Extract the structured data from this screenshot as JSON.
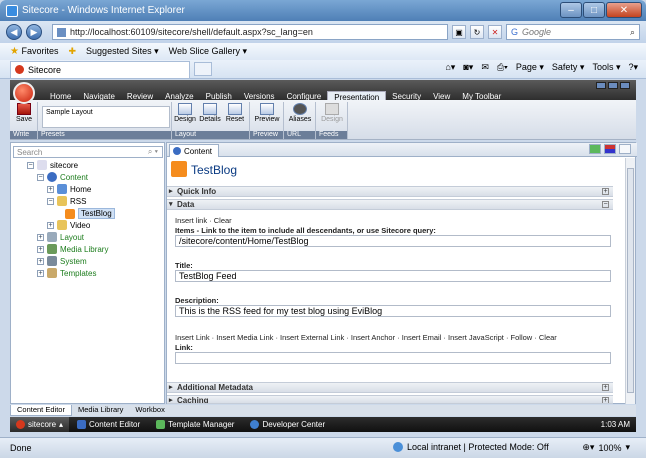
{
  "browser": {
    "title": "Sitecore - Windows Internet Explorer",
    "url": "http://localhost:60109/sitecore/shell/default.aspx?sc_lang=en",
    "search_placeholder": "Google",
    "favorites_label": "Favorites",
    "suggested_sites": "Suggested Sites ▾",
    "web_slice": "Web Slice Gallery ▾",
    "tab_label": "Sitecore",
    "cmd_page": "Page ▾",
    "cmd_safety": "Safety ▾",
    "cmd_tools": "Tools ▾",
    "status_done": "Done",
    "zone_text": "Local intranet | Protected Mode: Off",
    "zoom": "100%"
  },
  "sitecore": {
    "menu": [
      "Home",
      "Navigate",
      "Review",
      "Analyze",
      "Publish",
      "Versions",
      "Configure",
      "Presentation",
      "Security",
      "View",
      "My Toolbar"
    ],
    "active_menu": "Presentation",
    "ribbon": {
      "save": "Save",
      "write_group": "Write",
      "sample_layout": "Sample Layout",
      "presets_group": "Presets",
      "design": "Design",
      "details": "Details",
      "reset": "Reset",
      "layout_group": "Layout",
      "preview": "Preview",
      "preview_group": "Preview",
      "aliases": "Aliases",
      "url_group": "URL",
      "design_feeds": "Design",
      "feeds_group": "Feeds"
    },
    "search_placeholder": "Search",
    "tree": {
      "sitecore": "sitecore",
      "content": "Content",
      "home": "Home",
      "rss": "RSS",
      "testblog": "TestBlog",
      "video": "Video",
      "layout": "Layout",
      "media_library": "Media Library",
      "system": "System",
      "templates": "Templates"
    },
    "content_tab": "Content",
    "item_title": "TestBlog",
    "sections": {
      "quick_info": "Quick Info",
      "data": "Data",
      "additional_metadata": "Additional Metadata",
      "caching": "Caching"
    },
    "fields": {
      "items_links": "Insert link · Clear",
      "items_label": "Items - Link to the item to include all descendants, or use Sitecore query:",
      "items_value": "/sitecore/content/Home/TestBlog",
      "title_label": "Title:",
      "title_value": "TestBlog Feed",
      "description_label": "Description:",
      "description_value": "This is the RSS feed for my test blog using EviBlog",
      "link_actions": "Insert Link · Insert Media Link · Insert External Link · Insert Anchor · Insert Email · Insert JavaScript · Follow · Clear",
      "link_label": "Link:"
    },
    "bottom_tabs": [
      "Content Editor",
      "Media Library",
      "Workbox"
    ],
    "taskbar": {
      "start": "sitecore",
      "items": [
        "Content Editor",
        "Template Manager",
        "Developer Center"
      ],
      "clock": "1:03 AM"
    }
  }
}
